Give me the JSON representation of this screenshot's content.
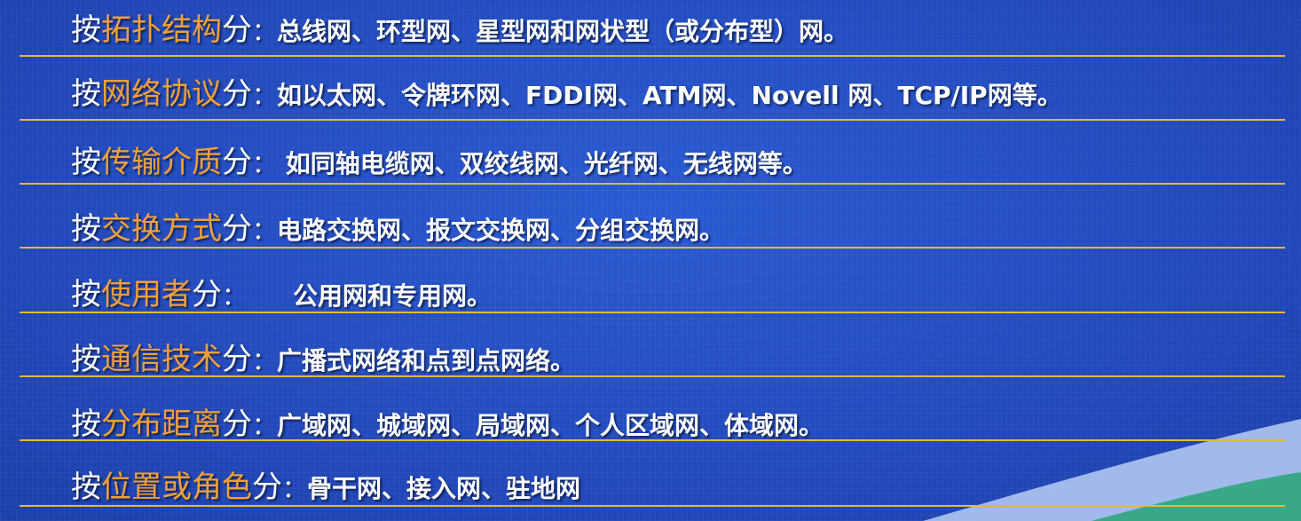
{
  "slide": {
    "rows": [
      {
        "prefix": "按",
        "category": "拓扑结构",
        "suffix": "分",
        "colon": "：",
        "description": "总线网、环型网、星型网和网状型（或分布型）网。"
      },
      {
        "prefix": "按",
        "category": "网络协议",
        "suffix": "分",
        "colon": "：",
        "description": "如以太网、令牌环网、FDDI网、ATM网、Novell 网、TCP/IP网等。"
      },
      {
        "prefix": "按",
        "category": "传输介质",
        "suffix": "分",
        "colon": "：",
        "description": " 如同轴电缆网、双绞线网、光纤网、无线网等。"
      },
      {
        "prefix": "按",
        "category": "交换方式",
        "suffix": "分",
        "colon": "：",
        "description": "电路交换网、报文交换网、分组交换网。"
      },
      {
        "prefix": "按",
        "category": "使用者",
        "suffix": "分",
        "colon": "：",
        "description": "公用网和专用网。"
      },
      {
        "prefix": "按",
        "category": "通信技术",
        "suffix": "分",
        "colon": "：",
        "description": "广播式网络和点到点网络。"
      },
      {
        "prefix": "按",
        "category": "分布距离",
        "suffix": "分",
        "colon": "：",
        "description": "广域网、城域网、局域网、个人区域网、体域网。"
      },
      {
        "prefix": "按",
        "category": "位置或角色",
        "suffix": "分",
        "colon": "：",
        "description": "骨干网、接入网、驻地网"
      }
    ],
    "colors": {
      "background": "#2350c4",
      "category_text": "#f0a038",
      "divider": "#e8b830",
      "body_text": "#ffffff",
      "corner_light": "#a9c0ee",
      "corner_green": "#3aa888"
    }
  }
}
